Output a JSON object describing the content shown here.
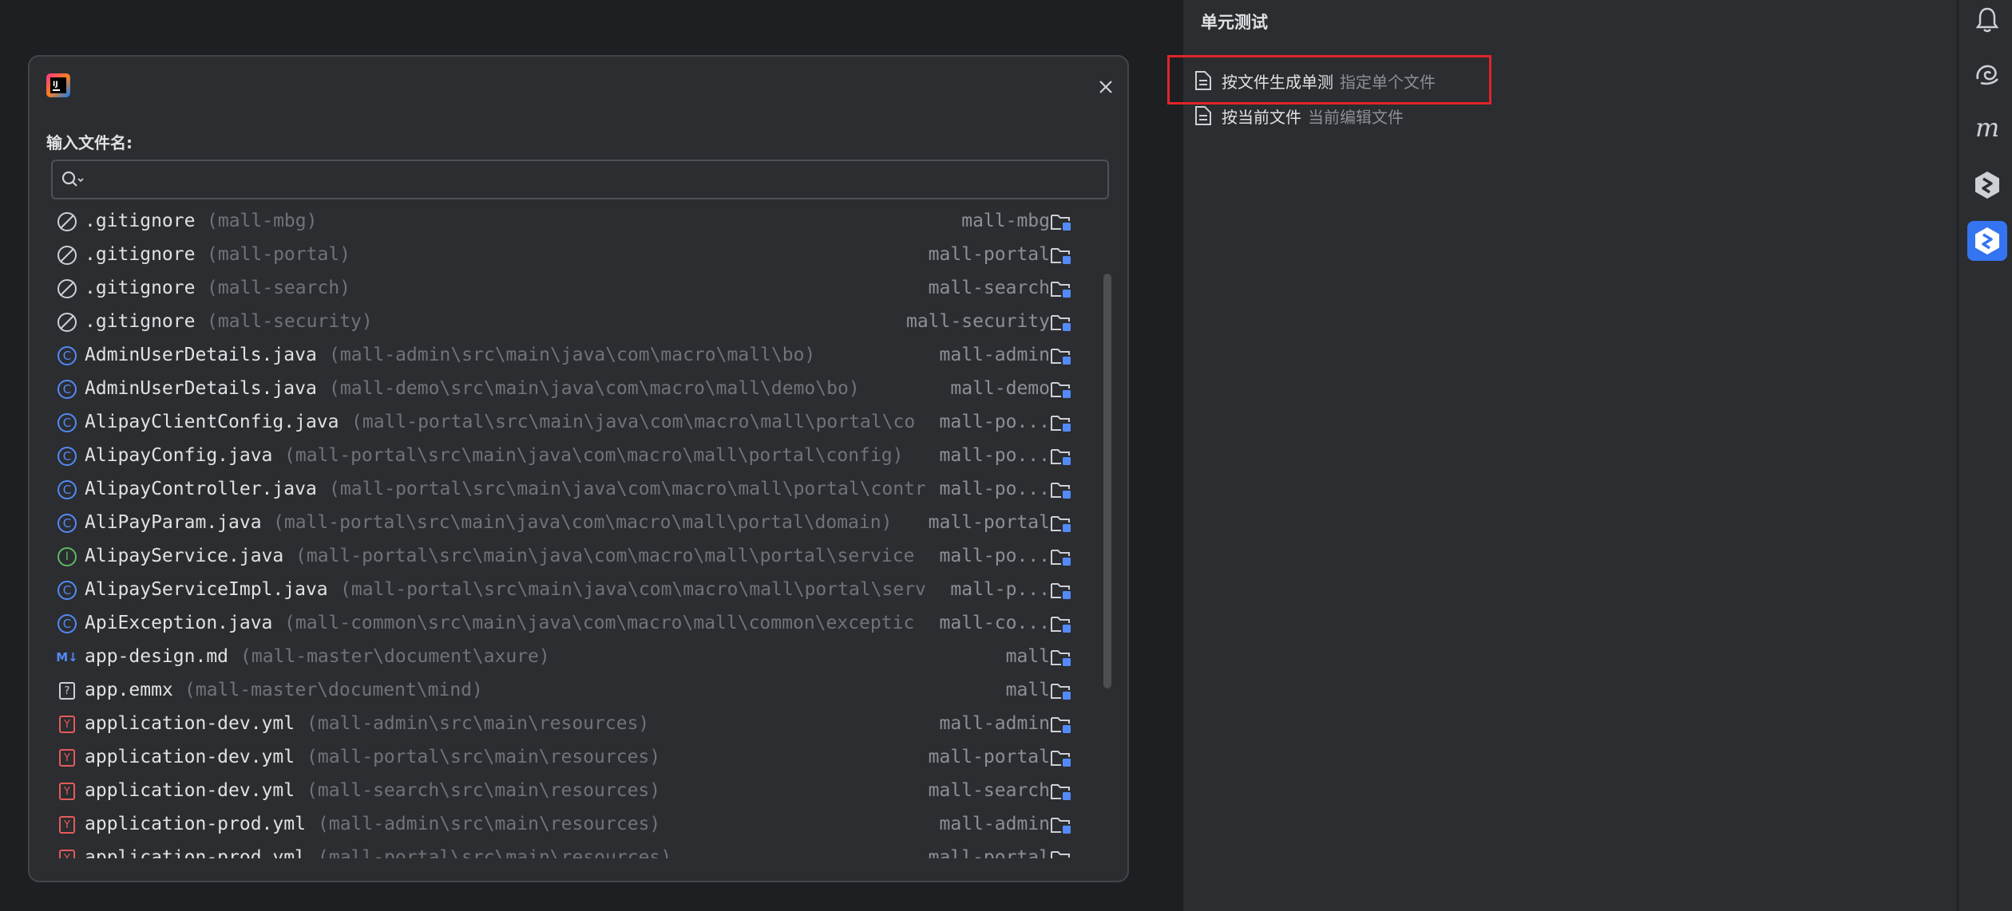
{
  "panel": {
    "title": "单元测试",
    "items": [
      {
        "main": "按文件生成单测",
        "hint": "指定单个文件"
      },
      {
        "main": "按当前文件",
        "hint": "当前编辑文件"
      }
    ]
  },
  "toolstrip": {
    "icons": [
      "bell-icon",
      "spiral-icon",
      "m-icon",
      "plugin-icon",
      "unit-test-plugin-icon"
    ]
  },
  "dialog": {
    "label": "输入文件名:",
    "search": {
      "value": "",
      "placeholder": ""
    },
    "results": [
      {
        "icon": "ignore",
        "name": ".gitignore",
        "path": "(mall-mbg)",
        "module": "mall-mbg"
      },
      {
        "icon": "ignore",
        "name": ".gitignore",
        "path": "(mall-portal)",
        "module": "mall-portal"
      },
      {
        "icon": "ignore",
        "name": ".gitignore",
        "path": "(mall-search)",
        "module": "mall-search"
      },
      {
        "icon": "ignore",
        "name": ".gitignore",
        "path": "(mall-security)",
        "module": "mall-security"
      },
      {
        "icon": "class",
        "name": "AdminUserDetails.java",
        "path": "(mall-admin\\src\\main\\java\\com\\macro\\mall\\bo)",
        "module": "mall-admin"
      },
      {
        "icon": "class",
        "name": "AdminUserDetails.java",
        "path": "(mall-demo\\src\\main\\java\\com\\macro\\mall\\demo\\bo)",
        "module": "mall-demo"
      },
      {
        "icon": "class",
        "name": "AlipayClientConfig.java",
        "path": "(mall-portal\\src\\main\\java\\com\\macro\\mall\\portal\\co",
        "module": "mall-po..."
      },
      {
        "icon": "class",
        "name": "AlipayConfig.java",
        "path": "(mall-portal\\src\\main\\java\\com\\macro\\mall\\portal\\config)",
        "module": "mall-po..."
      },
      {
        "icon": "class",
        "name": "AlipayController.java",
        "path": "(mall-portal\\src\\main\\java\\com\\macro\\mall\\portal\\contr",
        "module": "mall-po..."
      },
      {
        "icon": "class",
        "name": "AliPayParam.java",
        "path": "(mall-portal\\src\\main\\java\\com\\macro\\mall\\portal\\domain)",
        "module": "mall-portal"
      },
      {
        "icon": "interface",
        "name": "AlipayService.java",
        "path": "(mall-portal\\src\\main\\java\\com\\macro\\mall\\portal\\service",
        "module": "mall-po..."
      },
      {
        "icon": "class",
        "name": "AlipayServiceImpl.java",
        "path": "(mall-portal\\src\\main\\java\\com\\macro\\mall\\portal\\serv",
        "module": "mall-p..."
      },
      {
        "icon": "class",
        "name": "ApiException.java",
        "path": "(mall-common\\src\\main\\java\\com\\macro\\mall\\common\\exceptic",
        "module": "mall-co..."
      },
      {
        "icon": "markdown",
        "name": "app-design.md",
        "path": "(mall-master\\document\\axure)",
        "module": "mall"
      },
      {
        "icon": "unknown",
        "name": "app.emmx",
        "path": "(mall-master\\document\\mind)",
        "module": "mall"
      },
      {
        "icon": "yaml",
        "name": "application-dev.yml",
        "path": "(mall-admin\\src\\main\\resources)",
        "module": "mall-admin"
      },
      {
        "icon": "yaml",
        "name": "application-dev.yml",
        "path": "(mall-portal\\src\\main\\resources)",
        "module": "mall-portal"
      },
      {
        "icon": "yaml",
        "name": "application-dev.yml",
        "path": "(mall-search\\src\\main\\resources)",
        "module": "mall-search"
      },
      {
        "icon": "yaml",
        "name": "application-prod.yml",
        "path": "(mall-admin\\src\\main\\resources)",
        "module": "mall-admin"
      },
      {
        "icon": "yaml",
        "name": "application-prod.yml",
        "path": "(mall-portal\\src\\main\\resources)",
        "module": "mall-portal"
      }
    ]
  },
  "colors": {
    "accent": "#3574f0",
    "highlight": "#e0252a",
    "class_icon": "#548af7",
    "interface_icon": "#5fb865",
    "yaml_icon": "#e55b5b"
  }
}
